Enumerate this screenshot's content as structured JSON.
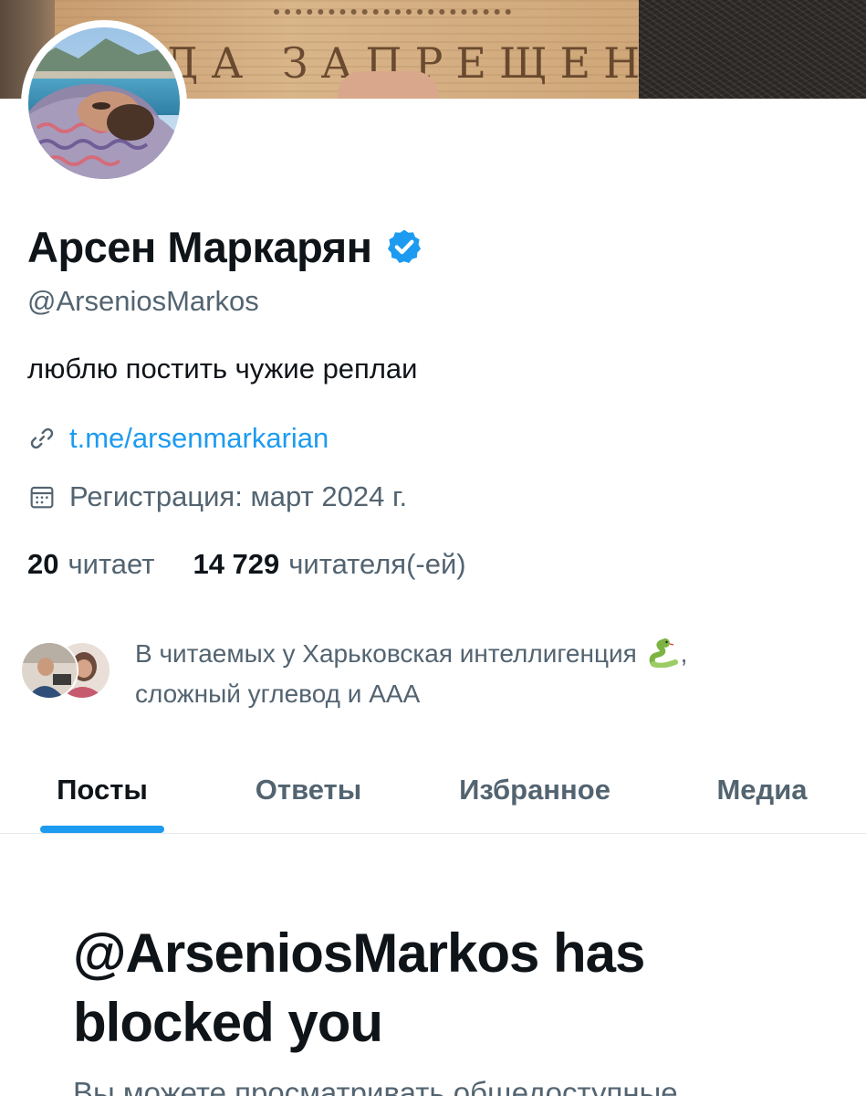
{
  "banner": {
    "burned_text": "ДА ЗАПРЕЩЕН"
  },
  "profile": {
    "name": "Арсен Маркарян",
    "handle": "@ArseniosMarkos",
    "bio": "люблю постить чужие реплаи",
    "link": "t.me/arsenmarkarian",
    "joined": "Регистрация: март 2024 г.",
    "following_count": "20",
    "following_label": "читает",
    "followers_count": "14 729",
    "followers_label": "читателя(-ей)",
    "verified_color": "#1d9bf0"
  },
  "followed_by": {
    "line1": "В читаемых у Харьковская интеллигенция",
    "line1_suffix": ",",
    "line2": "сложный углевод и ААА"
  },
  "tabs": [
    {
      "label": "Посты",
      "active": true
    },
    {
      "label": "Ответы",
      "active": false
    },
    {
      "label": "Избранное",
      "active": false
    },
    {
      "label": "Медиа",
      "active": false
    }
  ],
  "blocked": {
    "title": "@ArseniosMarkos has blocked you",
    "subtitle": "Вы можете просматривать общедоступные"
  },
  "colors": {
    "accent": "#1d9bf0",
    "text_primary": "#0f1419",
    "text_secondary": "#536471"
  }
}
